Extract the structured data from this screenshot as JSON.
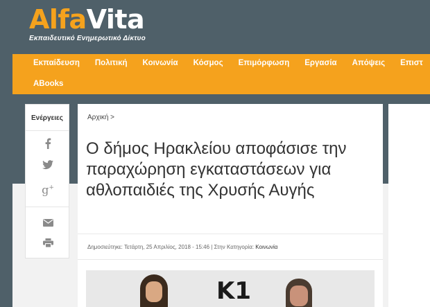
{
  "header": {
    "logo_part1": "Alfa",
    "logo_part2": "Vita",
    "tagline": "Εκπαιδευτικό Ενημερωτικό Δίκτυο",
    "brand_color": "#f5a21d",
    "header_color": "#4f6069"
  },
  "nav": {
    "row1": [
      "Εκπαίδευση",
      "Πολιτική",
      "Κοινωνία",
      "Κόσμος",
      "Επιμόρφωση",
      "Εργασία",
      "Απόψεις",
      "Επιστ"
    ],
    "row2": [
      "ABooks"
    ]
  },
  "share": {
    "title": "Ενέργειες",
    "icons": [
      "facebook-icon",
      "twitter-icon",
      "google-plus-icon",
      "email-icon",
      "print-icon"
    ]
  },
  "article": {
    "breadcrumb": "Αρχική >",
    "title": "Ο δήμος Ηρακλείου αποφάσισε την παραχώρηση εγκαταστάσεων για αθλοπαιδιές της Χρυσής Αυγής",
    "meta_prefix": "Δημοσιεύτηκε: Τετάρτη, 25 Απριλίος, 2018 - 15:46 | Στην Κατηγορία:",
    "meta_category": "Κοινωνία",
    "image_text": "K1"
  }
}
